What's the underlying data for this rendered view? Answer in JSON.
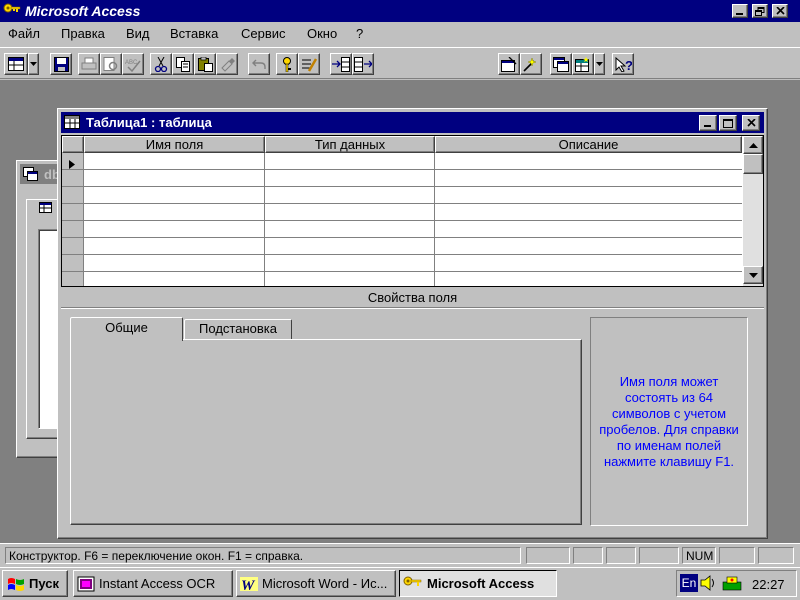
{
  "app": {
    "title": "Microsoft Access",
    "colors": {
      "title_active": "#000080",
      "desktop_workspace": "#808080",
      "face": "#c0c0c0",
      "help_text": "#0000ff"
    }
  },
  "menu": {
    "items": [
      {
        "id": "file",
        "label": "Файл"
      },
      {
        "id": "edit",
        "label": "Правка"
      },
      {
        "id": "view",
        "label": "Вид"
      },
      {
        "id": "insert",
        "label": "Вставка"
      },
      {
        "id": "tools",
        "label": "Сервис"
      },
      {
        "id": "window",
        "label": "Окно"
      },
      {
        "id": "help",
        "label": "?"
      }
    ]
  },
  "toolbar": {
    "icons": [
      "table-view-icon",
      "dropdown-arrow-icon",
      "save-icon",
      "print-icon",
      "print-preview-icon",
      "spelling-icon",
      "cut-icon",
      "copy-icon",
      "paste-icon",
      "format-painter-icon",
      "undo-icon",
      "primary-key-icon",
      "indexes-icon",
      "insert-row-icon",
      "delete-row-icon",
      "properties-icon",
      "build-icon",
      "database-window-icon",
      "new-object-icon",
      "help-icon"
    ]
  },
  "background_window": {
    "title_fragment": "db"
  },
  "table_window": {
    "title": "Таблица1 : таблица",
    "columns": [
      "Имя поля",
      "Тип данных",
      "Описание"
    ],
    "row_count": 8,
    "field_properties_label": "Свойства поля",
    "tabs": [
      {
        "id": "general",
        "label": "Общие",
        "active": true
      },
      {
        "id": "lookup",
        "label": "Подстановка",
        "active": false
      }
    ],
    "help_text": "Имя поля может состоять из 64 символов с учетом пробелов.  Для справки по именам полей нажмите клавишу F1."
  },
  "status_bar": {
    "text": "Конструктор.   F6 = переключение окон.   F1 = справка.",
    "num": "NUM"
  },
  "taskbar": {
    "start_label": "Пуск",
    "buttons": [
      {
        "id": "ocr",
        "label": "Instant Access OCR",
        "active": false
      },
      {
        "id": "word",
        "label": "Microsoft Word - Ис...",
        "active": false
      },
      {
        "id": "access",
        "label": "Microsoft Access",
        "active": true
      }
    ],
    "tray": {
      "lang": "En",
      "time": "22:27"
    }
  }
}
